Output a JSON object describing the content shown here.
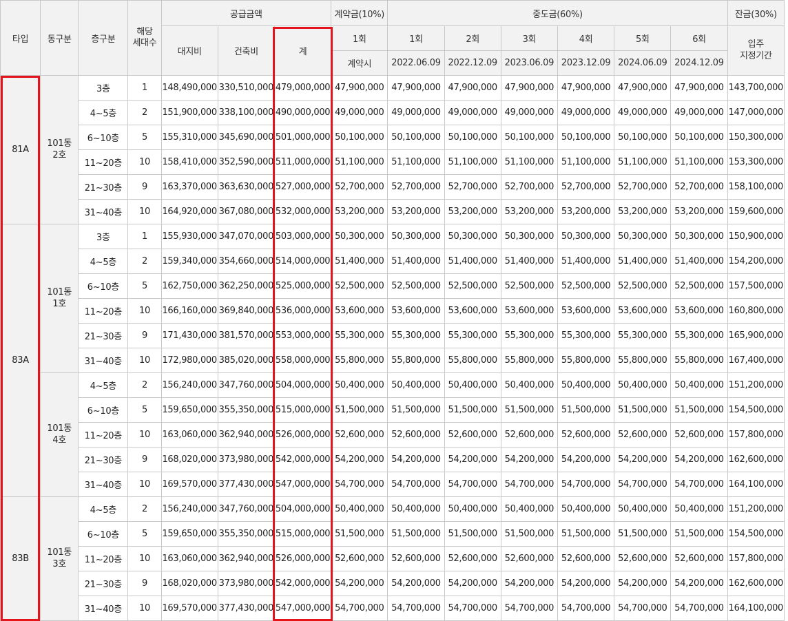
{
  "headers": {
    "type": "타입",
    "dong_group": "동구분",
    "floor_group": "층구분",
    "households": [
      "해당",
      "세대수"
    ],
    "supply": "공급금액",
    "land": "대지비",
    "building": "건축비",
    "total": "계",
    "contract": "계약금(10%)",
    "middle": "중도금(60%)",
    "balance": "잔금(30%)",
    "installments": [
      "1회",
      "1회",
      "2회",
      "3회",
      "4회",
      "5회",
      "6회"
    ],
    "dates": [
      "계약시",
      "2022.06.09",
      "2022.12.09",
      "2023.06.09",
      "2023.12.09",
      "2024.06.09",
      "2024.12.09"
    ],
    "balance_sub": [
      "입주",
      "지정기간"
    ]
  },
  "types": [
    {
      "type": "81A",
      "groups": [
        {
          "dong": [
            "101동",
            "2호"
          ],
          "rows": [
            {
              "floor": "3층",
              "count": "1",
              "land": "148,490,000",
              "build": "330,510,000",
              "total": "479,000,000",
              "contract": "47,900,000",
              "mid": "47,900,000",
              "balance": "143,700,000"
            },
            {
              "floor": "4~5층",
              "count": "2",
              "land": "151,900,000",
              "build": "338,100,000",
              "total": "490,000,000",
              "contract": "49,000,000",
              "mid": "49,000,000",
              "balance": "147,000,000"
            },
            {
              "floor": "6~10층",
              "count": "5",
              "land": "155,310,000",
              "build": "345,690,000",
              "total": "501,000,000",
              "contract": "50,100,000",
              "mid": "50,100,000",
              "balance": "150,300,000"
            },
            {
              "floor": "11~20층",
              "count": "10",
              "land": "158,410,000",
              "build": "352,590,000",
              "total": "511,000,000",
              "contract": "51,100,000",
              "mid": "51,100,000",
              "balance": "153,300,000"
            },
            {
              "floor": "21~30층",
              "count": "9",
              "land": "163,370,000",
              "build": "363,630,000",
              "total": "527,000,000",
              "contract": "52,700,000",
              "mid": "52,700,000",
              "balance": "158,100,000"
            },
            {
              "floor": "31~40층",
              "count": "10",
              "land": "164,920,000",
              "build": "367,080,000",
              "total": "532,000,000",
              "contract": "53,200,000",
              "mid": "53,200,000",
              "balance": "159,600,000"
            }
          ]
        }
      ]
    },
    {
      "type": "83A",
      "groups": [
        {
          "dong": [
            "101동",
            "1호"
          ],
          "rows": [
            {
              "floor": "3층",
              "count": "1",
              "land": "155,930,000",
              "build": "347,070,000",
              "total": "503,000,000",
              "contract": "50,300,000",
              "mid": "50,300,000",
              "balance": "150,900,000"
            },
            {
              "floor": "4~5층",
              "count": "2",
              "land": "159,340,000",
              "build": "354,660,000",
              "total": "514,000,000",
              "contract": "51,400,000",
              "mid": "51,400,000",
              "balance": "154,200,000"
            },
            {
              "floor": "6~10층",
              "count": "5",
              "land": "162,750,000",
              "build": "362,250,000",
              "total": "525,000,000",
              "contract": "52,500,000",
              "mid": "52,500,000",
              "balance": "157,500,000"
            },
            {
              "floor": "11~20층",
              "count": "10",
              "land": "166,160,000",
              "build": "369,840,000",
              "total": "536,000,000",
              "contract": "53,600,000",
              "mid": "53,600,000",
              "balance": "160,800,000"
            },
            {
              "floor": "21~30층",
              "count": "9",
              "land": "171,430,000",
              "build": "381,570,000",
              "total": "553,000,000",
              "contract": "55,300,000",
              "mid": "55,300,000",
              "balance": "165,900,000"
            },
            {
              "floor": "31~40층",
              "count": "10",
              "land": "172,980,000",
              "build": "385,020,000",
              "total": "558,000,000",
              "contract": "55,800,000",
              "mid": "55,800,000",
              "balance": "167,400,000"
            }
          ]
        },
        {
          "dong": [
            "101동",
            "4호"
          ],
          "rows": [
            {
              "floor": "4~5층",
              "count": "2",
              "land": "156,240,000",
              "build": "347,760,000",
              "total": "504,000,000",
              "contract": "50,400,000",
              "mid": "50,400,000",
              "balance": "151,200,000"
            },
            {
              "floor": "6~10층",
              "count": "5",
              "land": "159,650,000",
              "build": "355,350,000",
              "total": "515,000,000",
              "contract": "51,500,000",
              "mid": "51,500,000",
              "balance": "154,500,000"
            },
            {
              "floor": "11~20층",
              "count": "10",
              "land": "163,060,000",
              "build": "362,940,000",
              "total": "526,000,000",
              "contract": "52,600,000",
              "mid": "52,600,000",
              "balance": "157,800,000"
            },
            {
              "floor": "21~30층",
              "count": "9",
              "land": "168,020,000",
              "build": "373,980,000",
              "total": "542,000,000",
              "contract": "54,200,000",
              "mid": "54,200,000",
              "balance": "162,600,000"
            },
            {
              "floor": "31~40층",
              "count": "10",
              "land": "169,570,000",
              "build": "377,430,000",
              "total": "547,000,000",
              "contract": "54,700,000",
              "mid": "54,700,000",
              "balance": "164,100,000"
            }
          ]
        }
      ]
    },
    {
      "type": "83B",
      "groups": [
        {
          "dong": [
            "101동",
            "3호"
          ],
          "rows": [
            {
              "floor": "4~5층",
              "count": "2",
              "land": "156,240,000",
              "build": "347,760,000",
              "total": "504,000,000",
              "contract": "50,400,000",
              "mid": "50,400,000",
              "balance": "151,200,000"
            },
            {
              "floor": "6~10층",
              "count": "5",
              "land": "159,650,000",
              "build": "355,350,000",
              "total": "515,000,000",
              "contract": "51,500,000",
              "mid": "51,500,000",
              "balance": "154,500,000"
            },
            {
              "floor": "11~20층",
              "count": "10",
              "land": "163,060,000",
              "build": "362,940,000",
              "total": "526,000,000",
              "contract": "52,600,000",
              "mid": "52,600,000",
              "balance": "157,800,000"
            },
            {
              "floor": "21~30층",
              "count": "9",
              "land": "168,020,000",
              "build": "373,980,000",
              "total": "542,000,000",
              "contract": "54,200,000",
              "mid": "54,200,000",
              "balance": "162,600,000"
            },
            {
              "floor": "31~40층",
              "count": "10",
              "land": "169,570,000",
              "build": "377,430,000",
              "total": "547,000,000",
              "contract": "54,700,000",
              "mid": "54,700,000",
              "balance": "164,100,000"
            }
          ]
        }
      ]
    }
  ]
}
